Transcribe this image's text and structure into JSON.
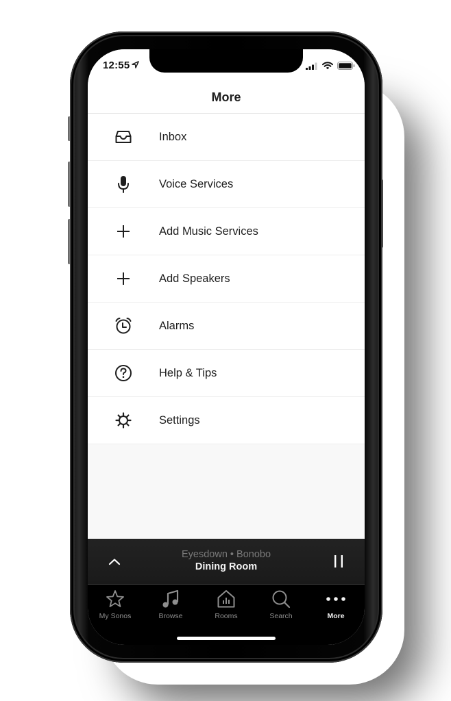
{
  "status_bar": {
    "time": "12:55",
    "location_icon": "location-arrow-icon",
    "signal_icon": "cellular-signal-icon",
    "wifi_icon": "wifi-icon",
    "battery_icon": "battery-icon"
  },
  "header": {
    "title": "More"
  },
  "menu": {
    "items": [
      {
        "label": "Inbox",
        "icon": "inbox-icon"
      },
      {
        "label": "Voice Services",
        "icon": "microphone-icon"
      },
      {
        "label": "Add Music Services",
        "icon": "plus-icon"
      },
      {
        "label": "Add Speakers",
        "icon": "plus-icon"
      },
      {
        "label": "Alarms",
        "icon": "alarm-clock-icon"
      },
      {
        "label": "Help & Tips",
        "icon": "question-circle-icon"
      },
      {
        "label": "Settings",
        "icon": "gear-icon"
      }
    ]
  },
  "now_playing": {
    "track": "Eyesdown",
    "separator": "•",
    "artist": "Bonobo",
    "track_line": "Eyesdown • Bonobo",
    "room": "Dining Room",
    "expand_icon": "chevron-up-icon",
    "pause_icon": "pause-icon"
  },
  "tabbar": {
    "active": "More",
    "tabs": [
      {
        "label": "My Sonos",
        "icon": "star-icon"
      },
      {
        "label": "Browse",
        "icon": "music-note-icon"
      },
      {
        "label": "Rooms",
        "icon": "house-icon"
      },
      {
        "label": "Search",
        "icon": "search-icon"
      },
      {
        "label": "More",
        "icon": "more-dots-icon"
      }
    ]
  },
  "colors": {
    "text_primary": "#1e1e1e",
    "player_bg": "#1f1f1f",
    "tabbar_bg": "#000000",
    "tab_inactive": "#8e8e8e",
    "tab_active": "#f2f2f2",
    "track_text": "#7a7a7a"
  }
}
